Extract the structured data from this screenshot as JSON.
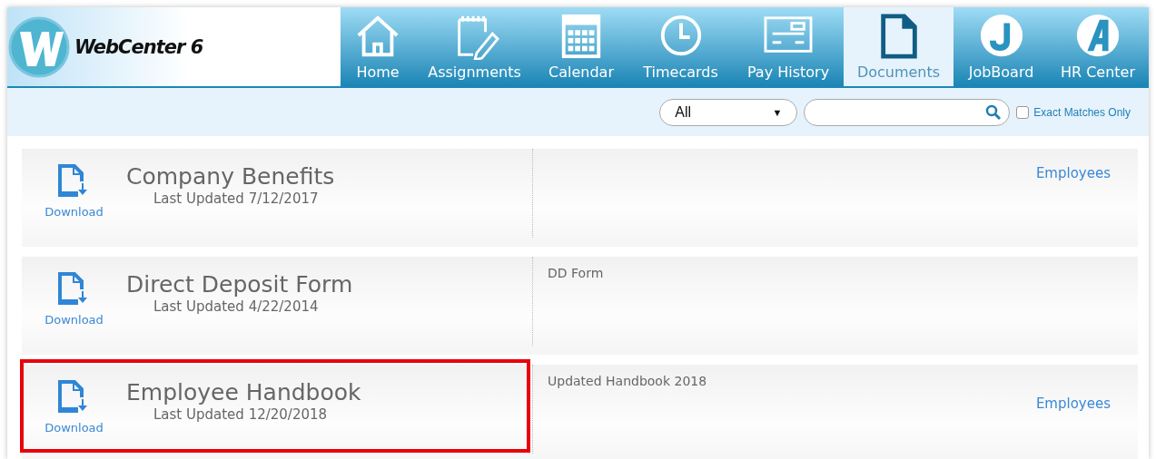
{
  "logo": {
    "text": "WebCenter 6"
  },
  "nav": [
    {
      "label": "Home",
      "selected": false
    },
    {
      "label": "Assignments",
      "selected": false
    },
    {
      "label": "Calendar",
      "selected": false
    },
    {
      "label": "Timecards",
      "selected": false
    },
    {
      "label": "Pay History",
      "selected": false
    },
    {
      "label": "Documents",
      "selected": true
    },
    {
      "label": "JobBoard",
      "selected": false
    },
    {
      "label": "HR Center",
      "selected": false
    }
  ],
  "filter": {
    "category": "All",
    "caret": "▼",
    "exact_label": "Exact Matches Only",
    "exact_checked": false
  },
  "documents": [
    {
      "title": "Company Benefits",
      "updated": "Last Updated 7/12/2017",
      "download": "Download",
      "audience": "Employees",
      "highlighted": false
    },
    {
      "title": "Direct Deposit Form",
      "updated": "Last Updated 4/22/2014",
      "download": "Download",
      "description": "DD Form",
      "highlighted": false
    },
    {
      "title": "Employee Handbook",
      "updated": "Last Updated 12/20/2018",
      "download": "Download",
      "description": "Updated Handbook 2018",
      "audience": "Employees",
      "highlighted": true
    }
  ]
}
